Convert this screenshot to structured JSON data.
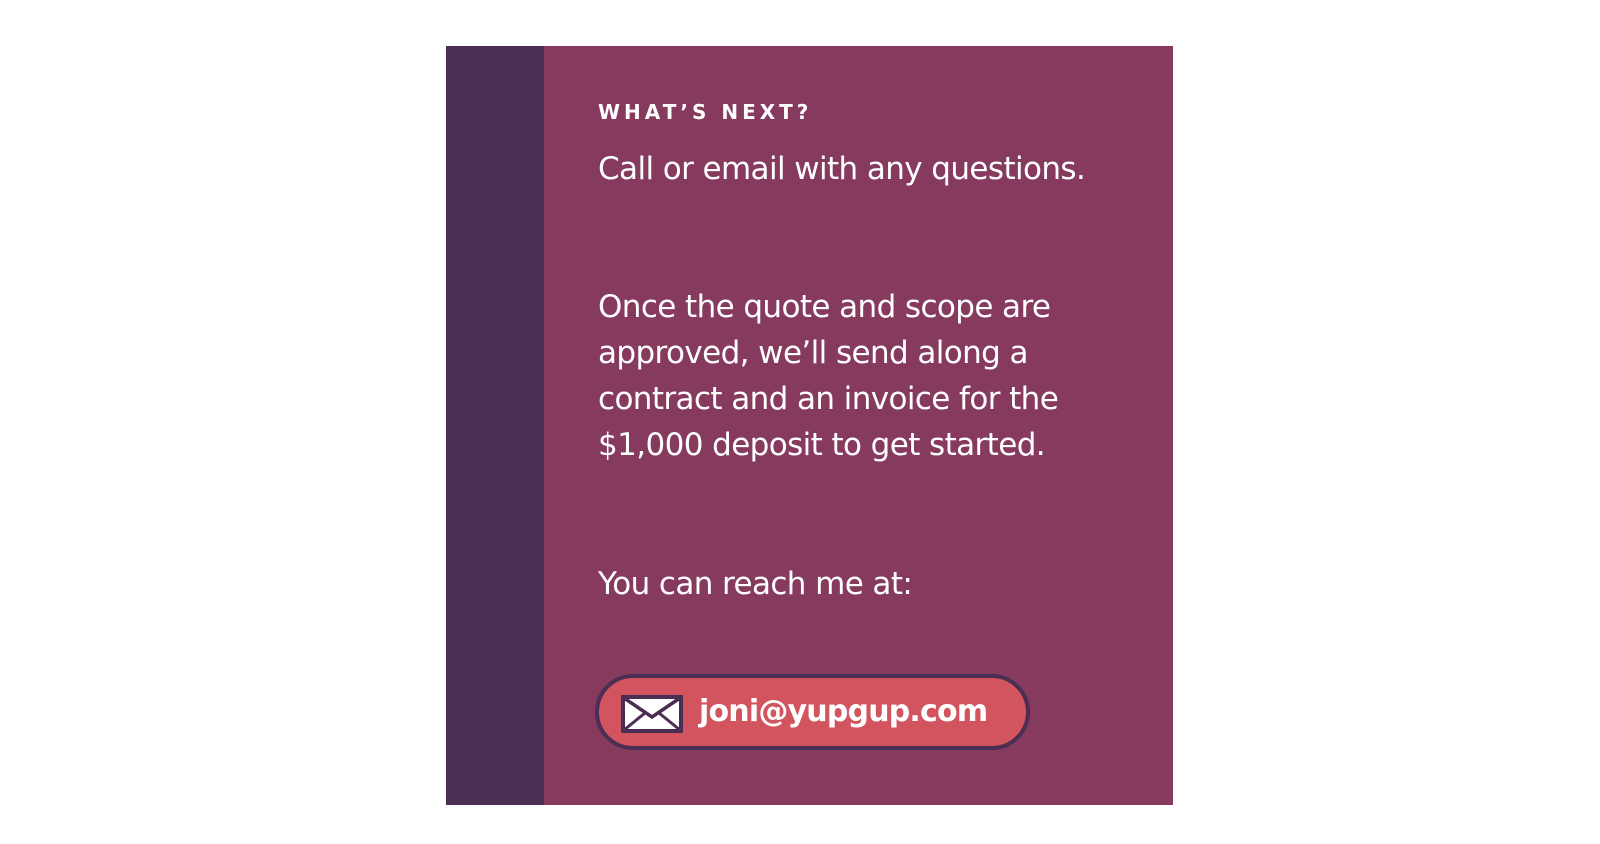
{
  "card": {
    "eyebrow": "WHAT’S NEXT?",
    "paragraph_1": "Call or email with any questions.",
    "paragraph_2": "Once the quote and scope are approved, we’ll send along a contract and an invoice for the $1,000 deposit to get started.",
    "paragraph_3": "You can reach me at:",
    "email": {
      "icon": "envelope-icon",
      "address": "joni@yupgup.com"
    }
  },
  "colors": {
    "card_background": "#853A5E",
    "side_bar": "#4C2D53",
    "email_pill": "#D2545F",
    "email_pill_border": "#4C2D53",
    "text": "#FFFFFF",
    "page_background": "#FFFFFF"
  }
}
